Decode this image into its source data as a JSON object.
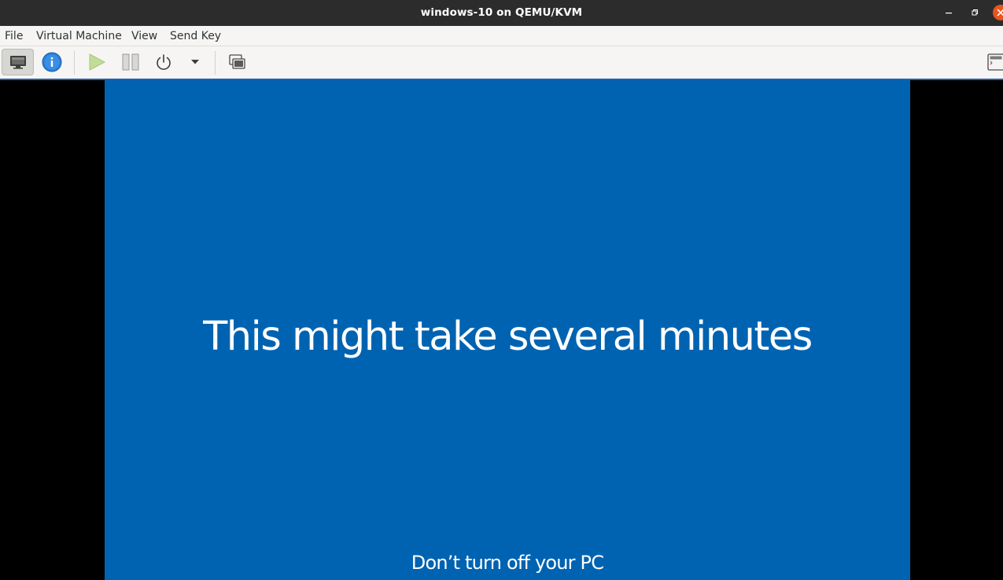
{
  "window": {
    "title": "windows-10 on QEMU/KVM",
    "controls": {
      "minimize_icon": "minimize-icon",
      "maximize_icon": "restore-icon",
      "close_icon": "close-icon",
      "close_color": "#e95420"
    }
  },
  "menubar": {
    "items": [
      {
        "label": "File"
      },
      {
        "label": "Virtual Machine"
      },
      {
        "label": "View"
      },
      {
        "label": "Send Key"
      }
    ]
  },
  "toolbar": {
    "buttons": [
      {
        "name": "console",
        "icon": "monitor-icon",
        "active": true
      },
      {
        "name": "details",
        "icon": "info-icon",
        "active": false
      },
      {
        "name": "run",
        "icon": "play-icon",
        "active": false
      },
      {
        "name": "pause",
        "icon": "pause-icon",
        "active": false
      },
      {
        "name": "shutdown",
        "icon": "power-icon",
        "active": false
      },
      {
        "name": "shutdown-menu",
        "icon": "dropdown-arrow-icon",
        "active": false
      },
      {
        "name": "snapshots",
        "icon": "snapshots-icon",
        "active": false
      },
      {
        "name": "fullscreen",
        "icon": "fullscreen-icon",
        "active": false
      }
    ],
    "accent": "#2a5fad"
  },
  "guest_screen": {
    "background": "#0063b1",
    "main_message": "This might take several minutes",
    "sub_message": "Don’t turn off your PC"
  }
}
